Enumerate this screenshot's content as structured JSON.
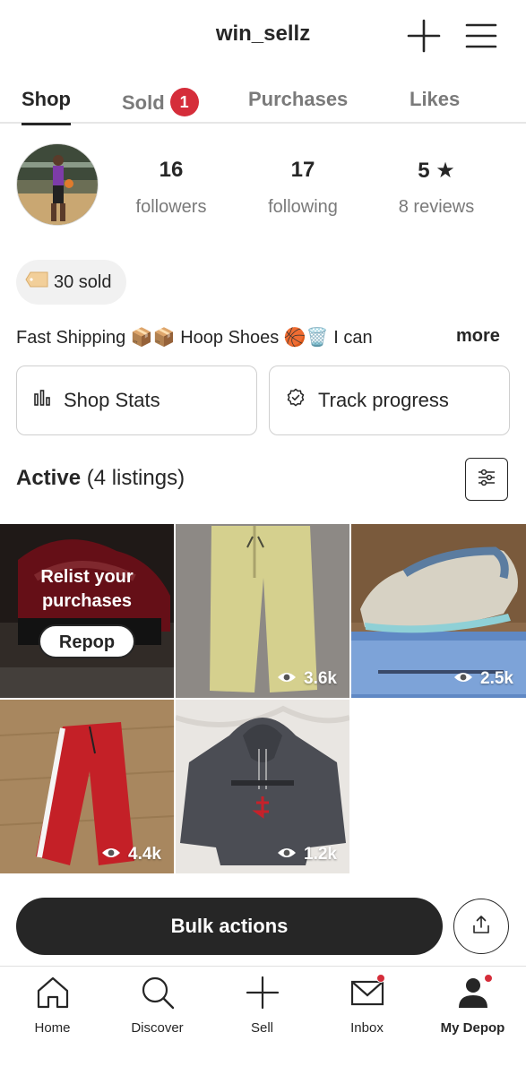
{
  "header": {
    "title": "win_sellz"
  },
  "tabs": [
    {
      "label": "Shop",
      "active": true
    },
    {
      "label": "Sold",
      "badge": "1"
    },
    {
      "label": "Purchases"
    },
    {
      "label": "Likes"
    }
  ],
  "profile": {
    "stats": [
      {
        "value": "16",
        "label": "followers"
      },
      {
        "value": "17",
        "label": "following"
      },
      {
        "value": "5 ★",
        "label": "8 reviews"
      }
    ],
    "sold": "30 sold",
    "bio": "Fast Shipping 📦📦 Hoop Shoes 🏀🗑️ I can",
    "bio_more": "more"
  },
  "actions": {
    "shop_stats": "Shop Stats",
    "track_progress": "Track progress"
  },
  "listings": {
    "title": "Active",
    "count": "(4 listings)",
    "relist_text": "Relist your purchases",
    "repop_label": "Repop",
    "items": [
      {
        "name": "pants",
        "views": "3.6k"
      },
      {
        "name": "sneakers",
        "views": "2.5k"
      },
      {
        "name": "track-pants",
        "views": "4.4k"
      },
      {
        "name": "hoodie",
        "views": "1.2k"
      }
    ]
  },
  "bulk_actions": "Bulk actions",
  "nav": [
    {
      "label": "Home",
      "icon": "home-icon"
    },
    {
      "label": "Discover",
      "icon": "search-icon"
    },
    {
      "label": "Sell",
      "icon": "plus-icon"
    },
    {
      "label": "Inbox",
      "icon": "mail-icon",
      "dot": true
    },
    {
      "label": "My Depop",
      "icon": "user-icon",
      "dot": true,
      "active": true
    }
  ],
  "colors": {
    "accent": "#d52d3a",
    "text": "#262626",
    "muted": "#7a7a7a"
  }
}
